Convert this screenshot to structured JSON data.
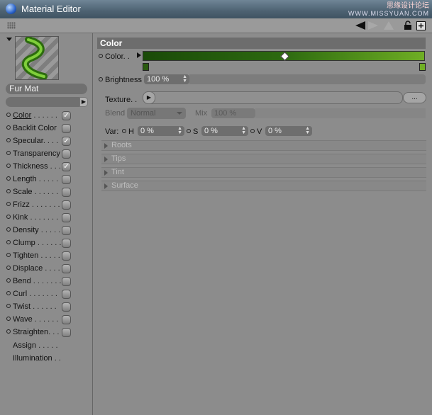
{
  "window": {
    "title": "Material Editor",
    "watermark_line1": "思缘设计论坛",
    "watermark_line2": "WWW.MISSYUAN.COM"
  },
  "material": {
    "name": "Fur Mat"
  },
  "channels": [
    {
      "label": "Color",
      "dots": " . . . . . .",
      "checked": true,
      "selected": true
    },
    {
      "label": "Backlit Color",
      "dots": "",
      "checked": false
    },
    {
      "label": "Specular",
      "dots": ". . . .",
      "checked": true
    },
    {
      "label": "Transparency",
      "dots": "",
      "checked": false
    },
    {
      "label": "Thickness",
      "dots": " . . .",
      "checked": true
    },
    {
      "label": "Length",
      "dots": " . . . . .",
      "checked": false
    },
    {
      "label": "Scale",
      "dots": " . . . . . .",
      "checked": false
    },
    {
      "label": "Frizz",
      "dots": " . . . . . . .",
      "checked": false
    },
    {
      "label": "Kink",
      "dots": " . . . . . . .",
      "checked": false
    },
    {
      "label": "Density",
      "dots": " . . . . .",
      "checked": false
    },
    {
      "label": "Clump",
      "dots": " . . . . . .",
      "checked": false
    },
    {
      "label": "Tighten",
      "dots": " . . . . .",
      "checked": false
    },
    {
      "label": "Displace",
      "dots": " . . . .",
      "checked": false
    },
    {
      "label": "Bend",
      "dots": " . . . . . . .",
      "checked": false
    },
    {
      "label": "Curl",
      "dots": " . . . . . . .",
      "checked": false
    },
    {
      "label": "Twist",
      "dots": " . . . . . .",
      "checked": false
    },
    {
      "label": "Wave",
      "dots": " . . . . . .",
      "checked": false
    },
    {
      "label": "Straighten",
      "dots": ". . .",
      "checked": false
    }
  ],
  "extra_channels": [
    {
      "label": "Assign",
      "dots": " . . . . ."
    },
    {
      "label": "Illumination",
      "dots": " . ."
    }
  ],
  "section": {
    "title": "Color",
    "color_label": "Color. .",
    "brightness_label": "Brightness",
    "brightness_value": "100 %",
    "brightness_level": 1.0,
    "texture_label": "Texture. .",
    "texture_more": "...",
    "blend_label": "Blend",
    "blend_value": "Normal",
    "mix_label": "Mix",
    "mix_value": "100 %",
    "var_label": "Var:",
    "h_label": "H",
    "h_value": "0 %",
    "s_label": "S",
    "s_value": "0 %",
    "v_label": "V",
    "v_value": "0 %",
    "gradient_colors": [
      "#1a4a08",
      "#2d6a10",
      "#6fae24"
    ]
  },
  "groups": [
    "Roots",
    "Tips",
    "Tint",
    "Surface"
  ]
}
